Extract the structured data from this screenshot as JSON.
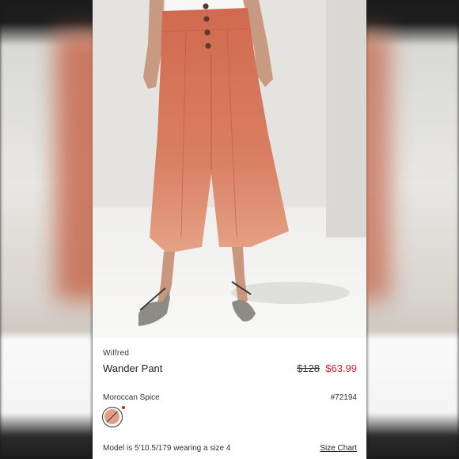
{
  "product": {
    "brand": "Wilfred",
    "name": "Wander Pant",
    "original_price": "$128",
    "sale_price": "$63.99",
    "color_name": "Moroccan Spice",
    "style_number": "#72194",
    "model_info": "Model is 5'10.5/179 wearing a size 4",
    "size_chart_label": "Size Chart"
  },
  "colors": {
    "sale_price": "#c8242b",
    "swatch": "#e39e86",
    "pant": "#d9785e"
  }
}
